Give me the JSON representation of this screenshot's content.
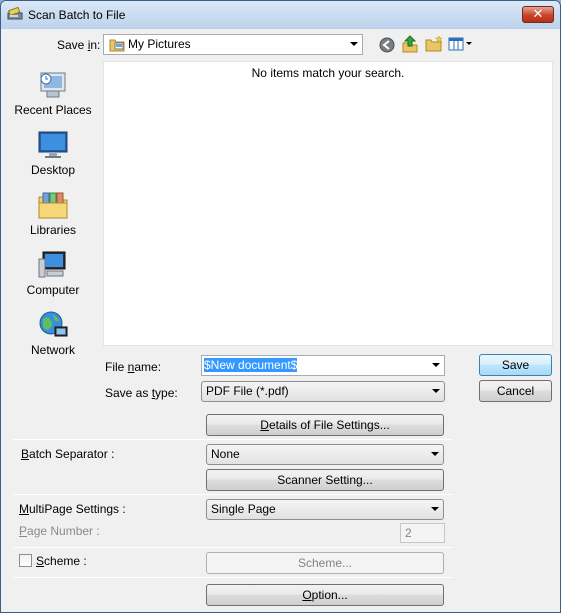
{
  "window": {
    "title": "Scan Batch to File",
    "close_symbol": "✕"
  },
  "save_in": {
    "label_prefix": "Save ",
    "label_underline": "i",
    "label_suffix": "n:",
    "value": "My Pictures"
  },
  "places": [
    {
      "label": "Recent Places",
      "icon": "recent-places-icon"
    },
    {
      "label": "Desktop",
      "icon": "desktop-icon"
    },
    {
      "label": "Libraries",
      "icon": "libraries-icon"
    },
    {
      "label": "Computer",
      "icon": "computer-icon"
    },
    {
      "label": "Network",
      "icon": "network-icon"
    }
  ],
  "file_list": {
    "empty_message": "No items match your search."
  },
  "file_name": {
    "label_prefix": "File ",
    "label_underline": "n",
    "label_suffix": "ame:",
    "value": "$New document$"
  },
  "save_as_type": {
    "label_prefix": "Save as ",
    "label_underline": "t",
    "label_suffix": "ype:",
    "value": "PDF File (*.pdf)"
  },
  "buttons": {
    "save": "Save",
    "cancel": "Cancel",
    "details_prefix": "",
    "details_underline": "D",
    "details_suffix": "etails of File Settings...",
    "scanner_setting": "Scanner Setting...",
    "scheme": "Scheme...",
    "option_prefix": "",
    "option_underline": "O",
    "option_suffix": "ption..."
  },
  "batch_separator": {
    "label_prefix": "",
    "label_underline": "B",
    "label_suffix": "atch Separator :",
    "value": "None"
  },
  "multipage": {
    "label_prefix": "",
    "label_underline": "M",
    "label_suffix": "ultiPage Settings :",
    "value": "Single Page",
    "page_number_prefix": "",
    "page_number_underline": "P",
    "page_number_suffix": "age Number :",
    "page_number_value": "2"
  },
  "scheme": {
    "label_prefix": "",
    "label_underline": "S",
    "label_suffix": "cheme :",
    "checked": false
  }
}
